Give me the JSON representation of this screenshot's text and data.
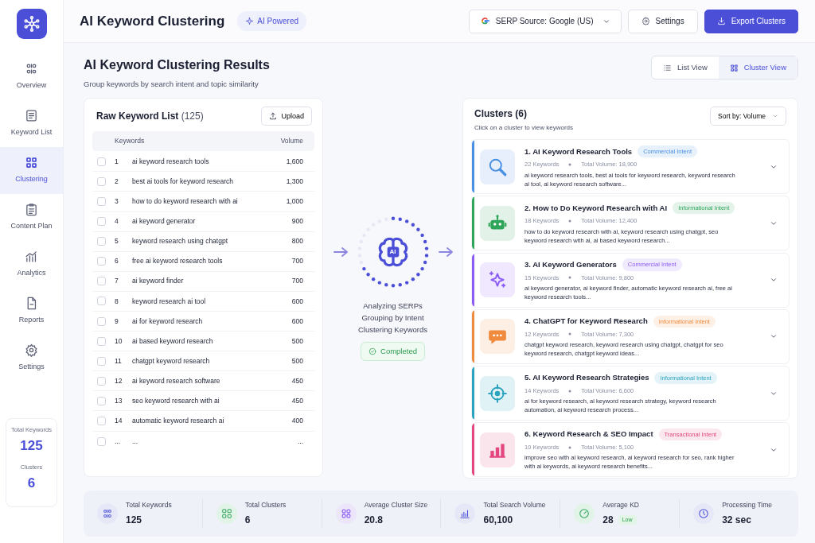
{
  "sidebar": {
    "items": [
      {
        "label": "Overview",
        "selected": false
      },
      {
        "label": "Keyword List",
        "selected": false
      },
      {
        "label": "Clustering",
        "selected": true
      },
      {
        "label": "Content Plan",
        "selected": false
      },
      {
        "label": "Analytics",
        "selected": false
      },
      {
        "label": "Reports",
        "selected": false
      },
      {
        "label": "Settings",
        "selected": false
      }
    ],
    "summary": [
      {
        "label": "Total Keywords",
        "value": "125"
      },
      {
        "label": "Clusters",
        "value": "6"
      }
    ]
  },
  "header": {
    "title": "AI Keyword Clustering",
    "badge": "AI Powered",
    "serp_source": "SERP Source: Google (US)",
    "settings": "Settings",
    "export": "Export Clusters"
  },
  "results": {
    "title": "AI Keyword Clustering Results",
    "subtitle": "Group keywords by search intent and topic similarity",
    "views": [
      {
        "label": "List View",
        "selected": false
      },
      {
        "label": "Cluster View",
        "selected": true
      }
    ]
  },
  "raw_list": {
    "title": "Raw Keyword List",
    "count": "(125)",
    "upload": "Upload",
    "columns": [
      "Keywords",
      "Volume"
    ],
    "rows": [
      {
        "checked": false,
        "number": "1",
        "keyword": "ai keyword research tools",
        "volume": "1,600"
      },
      {
        "checked": false,
        "number": "2",
        "keyword": "best ai tools for keyword research",
        "volume": "1,300"
      },
      {
        "checked": false,
        "number": "3",
        "keyword": "how to do keyword research with ai",
        "volume": "1,000"
      },
      {
        "checked": false,
        "number": "4",
        "keyword": "ai keyword generator",
        "volume": "900"
      },
      {
        "checked": false,
        "number": "5",
        "keyword": "keyword research using chatgpt",
        "volume": "800"
      },
      {
        "checked": false,
        "number": "6",
        "keyword": "free ai keyword research tools",
        "volume": "700"
      },
      {
        "checked": false,
        "number": "7",
        "keyword": "ai keyword finder",
        "volume": "700"
      },
      {
        "checked": false,
        "number": "8",
        "keyword": "keyword research ai tool",
        "volume": "600"
      },
      {
        "checked": false,
        "number": "9",
        "keyword": "ai for keyword research",
        "volume": "600"
      },
      {
        "checked": false,
        "number": "10",
        "keyword": "ai based keyword research",
        "volume": "500"
      },
      {
        "checked": false,
        "number": "11",
        "keyword": "chatgpt keyword research",
        "volume": "500"
      },
      {
        "checked": false,
        "number": "12",
        "keyword": "ai keyword research software",
        "volume": "450"
      },
      {
        "checked": false,
        "number": "13",
        "keyword": "seo keyword research with ai",
        "volume": "450"
      },
      {
        "checked": false,
        "number": "14",
        "keyword": "automatic keyword research ai",
        "volume": "400"
      },
      {
        "checked": false,
        "number": "...",
        "keyword": "...",
        "volume": "..."
      }
    ]
  },
  "process": {
    "chip_label": "AI",
    "level": 0.7,
    "steps": [
      "Analyzing SERPs",
      "Grouping by Intent",
      "Clustering Keywords"
    ],
    "status": "Completed"
  },
  "clusters": {
    "title": "Clusters (6)",
    "subtitle": "Click on a cluster to view keywords",
    "sort": "Sort by: Volume",
    "items": [
      {
        "title": "1. AI Keyword Research Tools",
        "intent": "Commercial Intent",
        "color": "#4a90e2",
        "count": "22 Keywords",
        "volume": "Total Volume: 18,900",
        "keywords": "ai keyword research tools, best ai tools for keyword research, keyword research ai tool, ai keyword research software..."
      },
      {
        "title": "2. How to Do Keyword Research with AI",
        "intent": "Informational Intent",
        "color": "#2fa55a",
        "count": "18 Keywords",
        "volume": "Total Volume: 12,400",
        "keywords": "how to do keyword research with ai, keyword research using chatgpt, seo keyword research with ai, ai based keyword research..."
      },
      {
        "title": "3. AI Keyword Generators",
        "intent": "Commercial Intent",
        "color": "#8b5cf6",
        "count": "15 Keywords",
        "volume": "Total Volume: 9,800",
        "keywords": "ai keyword generator, ai keyword finder, automatic keyword research ai, free ai keyword research tools..."
      },
      {
        "title": "4. ChatGPT for Keyword Research",
        "intent": "Informational Intent",
        "color": "#f08a3c",
        "count": "12 Keywords",
        "volume": "Total Volume: 7,300",
        "keywords": "chatgpt keyword research, keyword research using chatgpt, chatgpt for seo keyword research, chatgpt keyword ideas..."
      },
      {
        "title": "5. AI Keyword Research Strategies",
        "intent": "Informational Intent",
        "color": "#2aa3bf",
        "count": "14 Keywords",
        "volume": "Total Volume: 6,600",
        "keywords": "ai for keyword research, ai keyword research strategy, keyword research automation, ai keyword research process..."
      },
      {
        "title": "6. Keyword Research & SEO Impact",
        "intent": "Transactional Intent",
        "color": "#e4467f",
        "count": "10 Keywords",
        "volume": "Total Volume: 5,100",
        "keywords": "improve seo with ai keyword research, ai keyword research for seo, rank higher with ai keywords, ai keyword research benefits..."
      }
    ]
  },
  "stats": [
    {
      "label": "Total Keywords",
      "value": "125"
    },
    {
      "label": "Total Clusters",
      "value": "6"
    },
    {
      "label": "Average Cluster Size",
      "value": "20.8"
    },
    {
      "label": "Total Search Volume",
      "value": "60,100"
    },
    {
      "label": "Average KD",
      "value": "28",
      "badge": "Low"
    },
    {
      "label": "Processing Time",
      "value": "32 sec"
    }
  ]
}
